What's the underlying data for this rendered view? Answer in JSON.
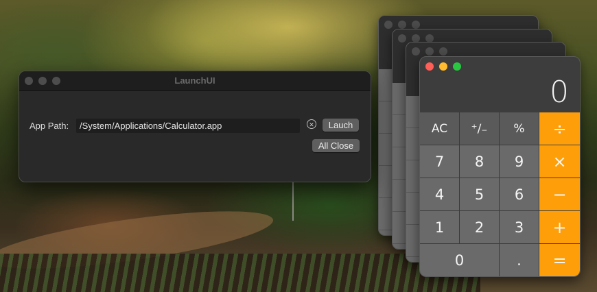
{
  "launch_window": {
    "title": "LaunchUI",
    "path_label": "App Path:",
    "path_value": "/System/Applications/Calculator.app",
    "clear_icon": "clear-circle-icon",
    "launch_label": "Lauch",
    "all_close_label": "All Close"
  },
  "calculator": {
    "display": "0",
    "keys": [
      "AC",
      "⁺∕₋",
      "%",
      "÷",
      "7",
      "8",
      "9",
      "×",
      "4",
      "5",
      "6",
      "−",
      "1",
      "2",
      "3",
      "+",
      "0",
      ".",
      "="
    ],
    "colors": {
      "operator": "#fe9f0a",
      "digit": "#6a6a6a",
      "function": "#5a5a5a"
    }
  },
  "calculator_stack_back_count": 3
}
